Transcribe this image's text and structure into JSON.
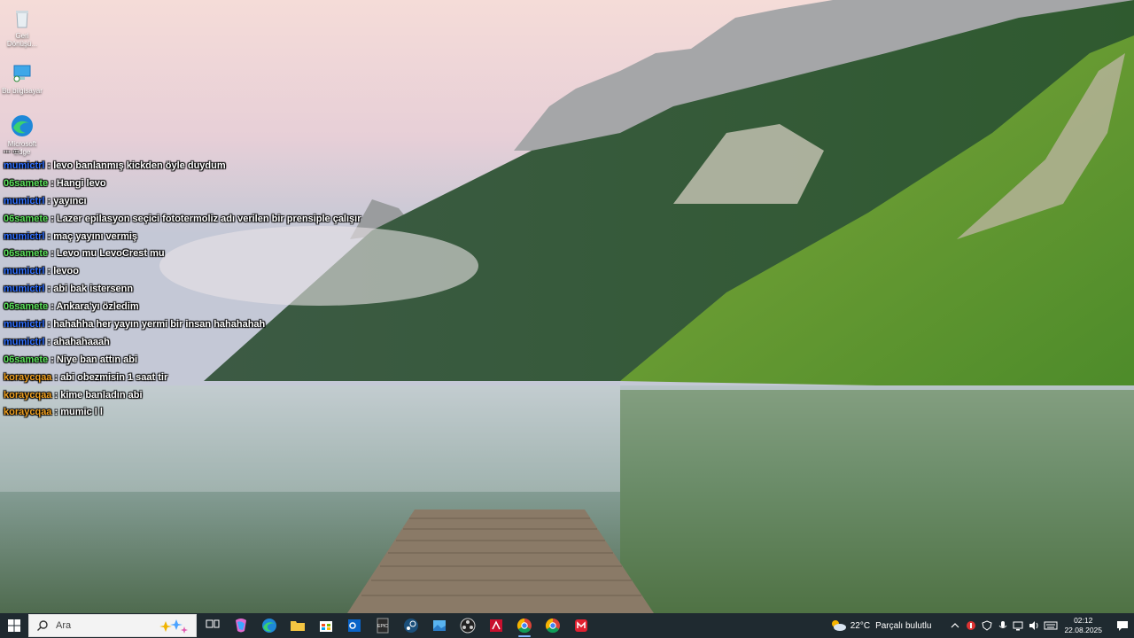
{
  "desktop": {
    "icons": [
      {
        "label": "Geri\nDönüşü...",
        "icon": "recycle-bin-icon"
      },
      {
        "label": "Bu bilgisayar",
        "icon": "this-pc-icon"
      },
      {
        "label": "Microsoft\nEdge",
        "icon": "edge-icon"
      }
    ]
  },
  "chat": {
    "partial_top": "... ...",
    "messages": [
      {
        "user": "mumictrl",
        "text": " : levo banlanmış kickden öyle duydum",
        "color": "#2f6fff"
      },
      {
        "user": "06samete",
        "text": " : Hangi levo",
        "color": "#5de35d"
      },
      {
        "user": "mumictrl",
        "text": " : yayıncı",
        "color": "#2f6fff"
      },
      {
        "user": "06samete",
        "text": " : Lazer epilasyon seçici fototermoliz adı verilen bir prensiple çalışır",
        "color": "#5de35d"
      },
      {
        "user": "mumictrl",
        "text": " : maç yayını vermiş",
        "color": "#2f6fff"
      },
      {
        "user": "06samete",
        "text": " : Levo mu LevoCrest mu",
        "color": "#5de35d"
      },
      {
        "user": "mumictrl",
        "text": " : levoo",
        "color": "#2f6fff"
      },
      {
        "user": "mumictrl",
        "text": " : abi bak istersenn",
        "color": "#2f6fff"
      },
      {
        "user": "06samete",
        "text": " : Ankara'yı özledim",
        "color": "#5de35d"
      },
      {
        "user": "mumictrl",
        "text": " : hahahha her yayın yermi bir insan hahahahah",
        "color": "#2f6fff"
      },
      {
        "user": "mumictrl",
        "text": " : ahahahaaah",
        "color": "#2f6fff"
      },
      {
        "user": "06samete",
        "text": " : Niye ban attın abi",
        "color": "#5de35d"
      },
      {
        "user": "koraycqaa",
        "text": " : abi obezmisin 1 saat tir",
        "color": "#f0a020"
      },
      {
        "user": "koraycqaa",
        "text": " : kime banladın abi",
        "color": "#f0a020"
      },
      {
        "user": "koraycqaa",
        "text": " : mumic l l",
        "color": "#f0a020"
      }
    ]
  },
  "taskbar": {
    "search_placeholder": "Ara",
    "apps": [
      {
        "name": "task-view-icon"
      },
      {
        "name": "copilot-icon"
      },
      {
        "name": "edge-icon"
      },
      {
        "name": "file-explorer-icon"
      },
      {
        "name": "microsoft-store-icon"
      },
      {
        "name": "outlook-icon"
      },
      {
        "name": "epic-games-icon",
        "label": "EPIC"
      },
      {
        "name": "steam-icon"
      },
      {
        "name": "photos-icon"
      },
      {
        "name": "obs-icon"
      },
      {
        "name": "amd-adrenalin-icon"
      },
      {
        "name": "chrome-icon",
        "active": true
      },
      {
        "name": "chrome-icon-2"
      },
      {
        "name": "red-app-icon"
      }
    ],
    "weather": {
      "temp": "22°C",
      "desc": "Parçalı bulutlu"
    },
    "clock": {
      "time": "02:12",
      "date": "22.08.2025"
    }
  },
  "colors": {
    "taskbar_bg": "#1f2a30",
    "accent": "#7fb7ff"
  }
}
